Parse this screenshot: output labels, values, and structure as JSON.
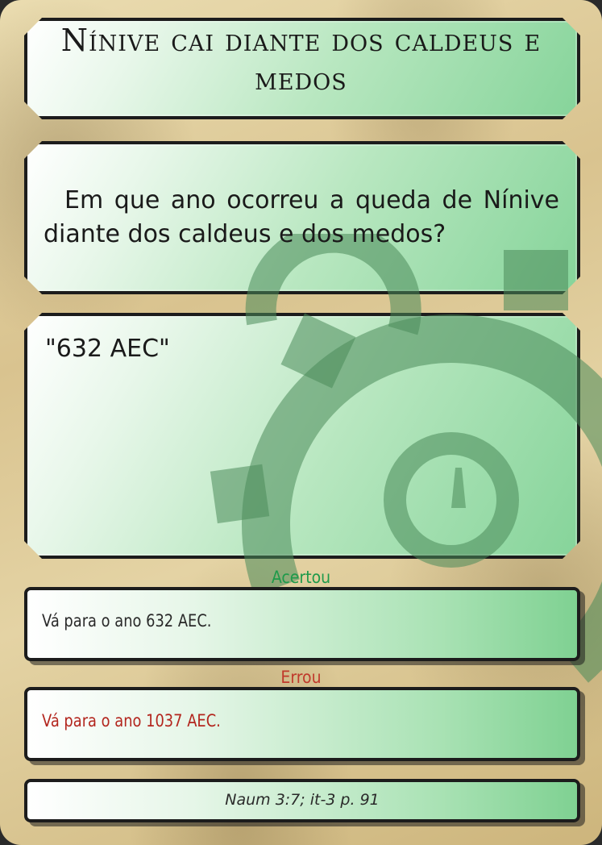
{
  "card": {
    "title": "Nínive cai diante dos caldeus e medos",
    "question": "Em que ano ocorreu a queda de Nínive diante dos caldeus e dos medos?",
    "answer": "\"632 AEC\"",
    "correct_label": "Acertou",
    "correct_text": "Vá para o ano 632 AEC.",
    "wrong_label": "Errou",
    "wrong_text": "Vá para o ano 1037 AEC.",
    "reference": "Naum 3:7; it-3 p. 91"
  },
  "colors": {
    "correct": "#1e9a4a",
    "wrong": "#c0392b",
    "panel_green": "#86d49a"
  },
  "icons": {
    "watermark": "stopwatch-icon"
  }
}
